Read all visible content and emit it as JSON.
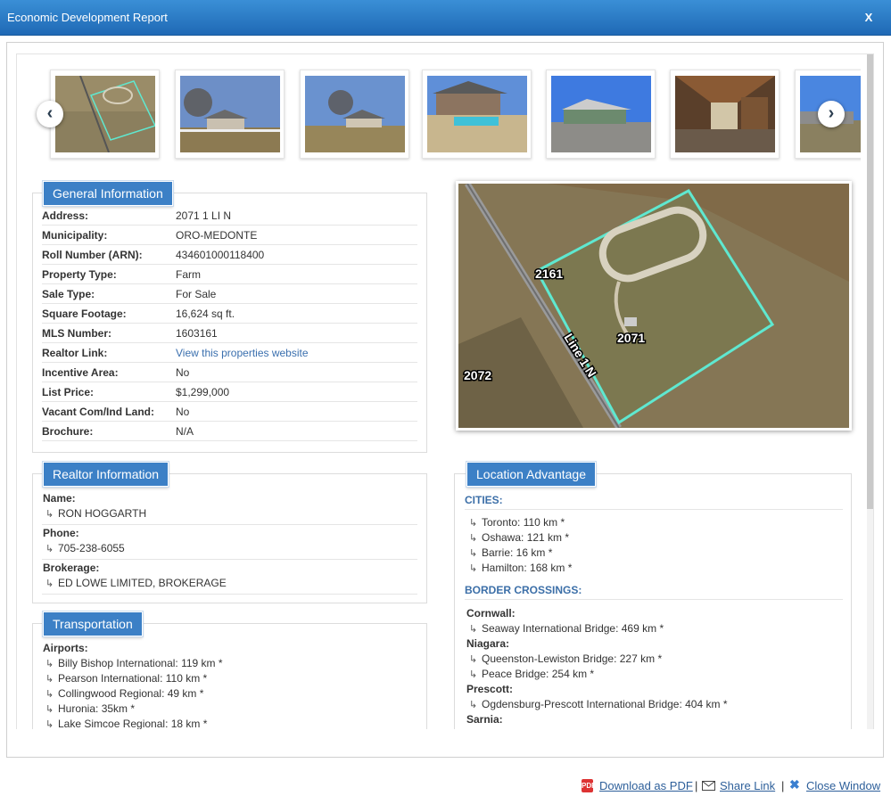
{
  "window": {
    "title": "Economic Development Report",
    "close_label": "X"
  },
  "gallery": {
    "prev_icon": "‹",
    "next_icon": "›",
    "thumbnails": [
      "aerial parcel map",
      "farm house with trees",
      "farm house and lawn",
      "house with pool",
      "barn and driveway",
      "barn stable interior",
      "barn exterior"
    ]
  },
  "map": {
    "labels": {
      "lot_a": "2161",
      "lot_b": "2071",
      "lot_c": "2072",
      "road": "Line 1 N"
    }
  },
  "general": {
    "title": "General Information",
    "rows": [
      {
        "label": "Address:",
        "value": "2071 1 LI N"
      },
      {
        "label": "Municipality:",
        "value": "ORO-MEDONTE"
      },
      {
        "label": "Roll Number (ARN):",
        "value": "434601000118400"
      },
      {
        "label": "Property Type:",
        "value": "Farm"
      },
      {
        "label": "Sale Type:",
        "value": "For Sale"
      },
      {
        "label": "Square Footage:",
        "value": "16,624 sq ft."
      },
      {
        "label": "MLS Number:",
        "value": "1603161"
      },
      {
        "label": "Realtor Link:",
        "value": "View this properties website"
      },
      {
        "label": "Incentive Area:",
        "value": "No"
      },
      {
        "label": "List Price:",
        "value": "$1,299,000"
      },
      {
        "label": "Vacant Com/Ind Land:",
        "value": "No"
      },
      {
        "label": "Brochure:",
        "value": "N/A"
      }
    ]
  },
  "realtor": {
    "title": "Realtor Information",
    "name_label": "Name:",
    "name": "RON HOGGARTH",
    "phone_label": "Phone:",
    "phone": "705-238-6055",
    "brokerage_label": "Brokerage:",
    "brokerage": "ED LOWE LIMITED, BROKERAGE"
  },
  "transportation": {
    "title": "Transportation",
    "airports_label": "Airports:",
    "airports": [
      "Billy Bishop International: 119 km *",
      "Pearson International: 110 km *",
      "Collingwood Regional: 49 km *",
      "Huronia: 35km *",
      "Lake Simcoe Regional: 18 km *"
    ]
  },
  "location": {
    "title": "Location Advantage",
    "cities_header": "CITIES:",
    "cities": [
      "Toronto: 110 km *",
      "Oshawa: 121 km *",
      "Barrie: 16 km *",
      "Hamilton: 168 km *"
    ],
    "border_header": "BORDER CROSSINGS:",
    "border_groups": [
      {
        "name": "Cornwall:",
        "items": [
          "Seaway International Bridge: 469 km *"
        ]
      },
      {
        "name": "Niagara:",
        "items": [
          "Queenston-Lewiston Bridge: 227 km *",
          "Peace Bridge: 254 km *"
        ]
      },
      {
        "name": "Prescott:",
        "items": [
          "Ogdensburg-Prescott International Bridge: 404 km *"
        ]
      },
      {
        "name": "Sarnia:",
        "items": []
      }
    ]
  },
  "footer": {
    "pdf": "Download as PDF",
    "sep": "|",
    "share": "Share Link",
    "close": "Close Window"
  },
  "colors": {
    "titlebar": "#2a7bc6",
    "tab": "#3c80c6",
    "link": "#2d5f9a",
    "parcel": "#5fe8d0"
  }
}
